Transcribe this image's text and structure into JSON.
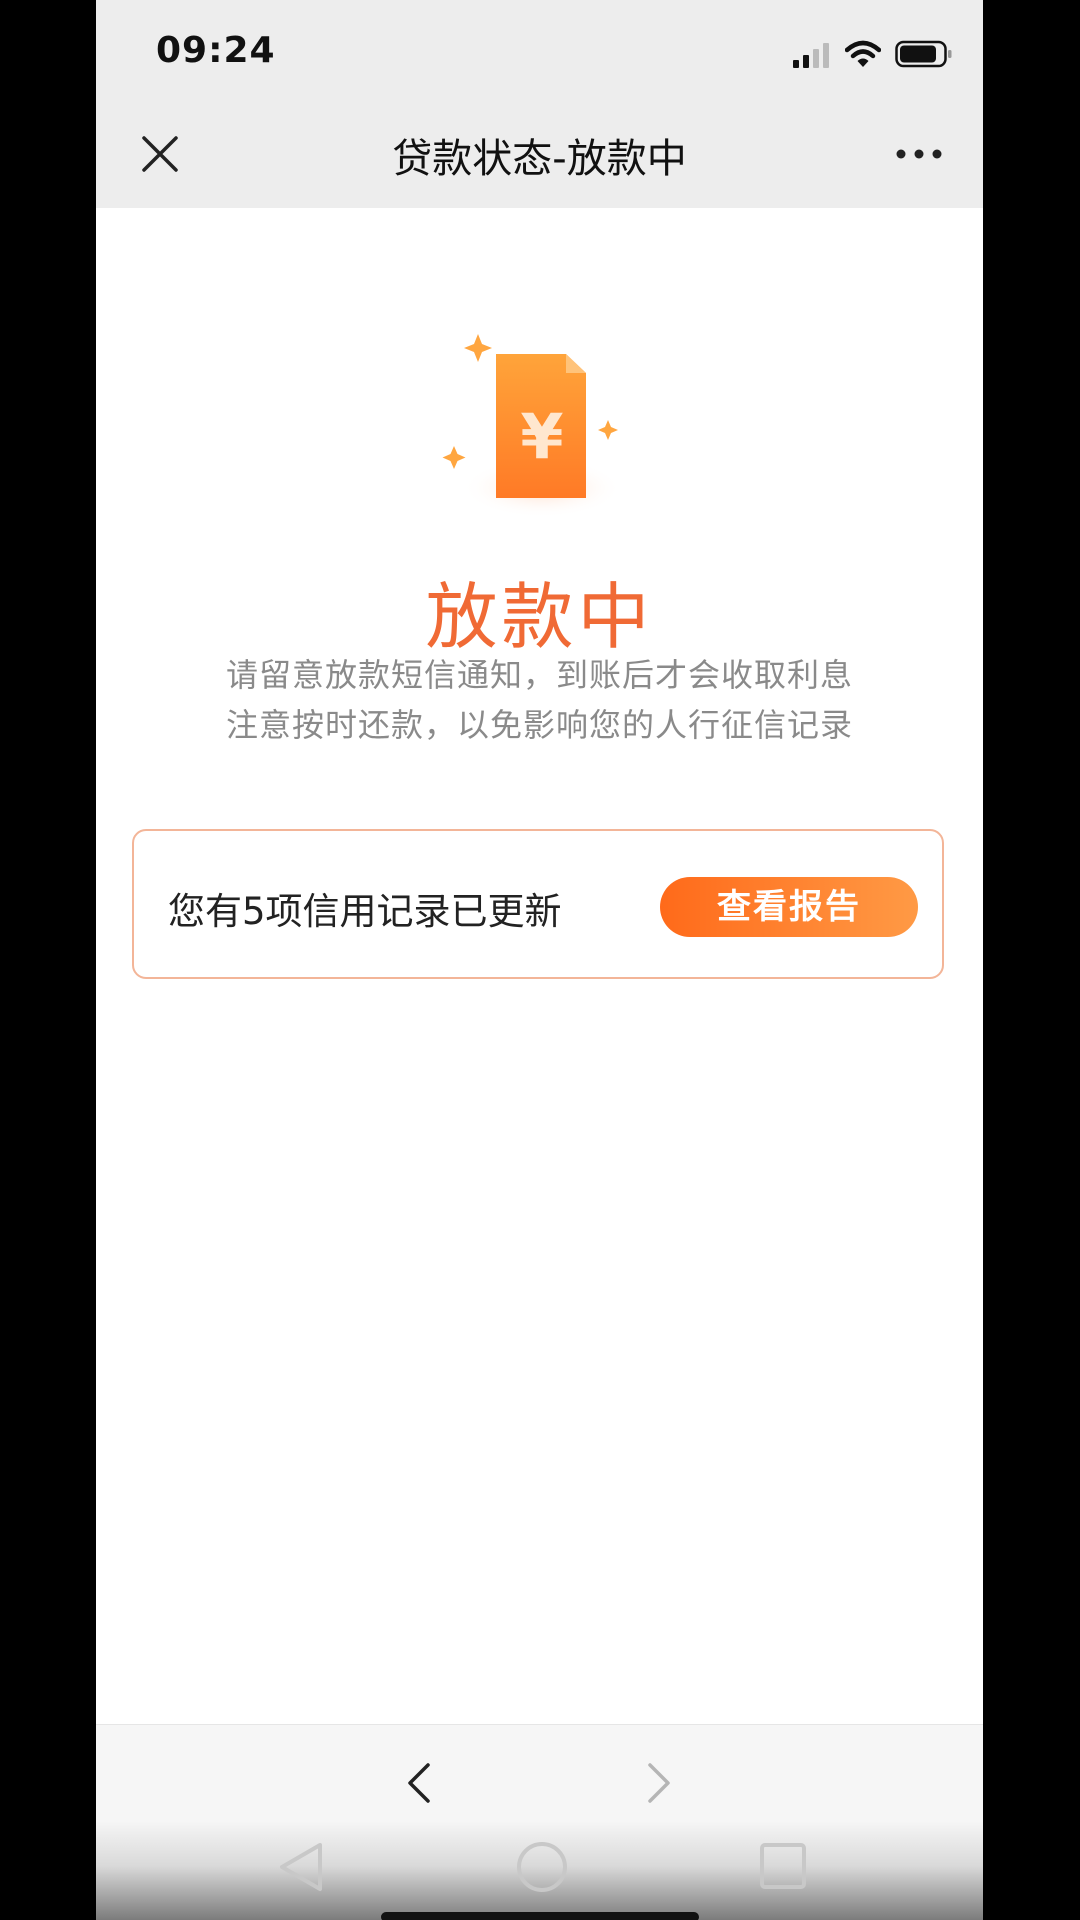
{
  "status_bar": {
    "time": "09:24",
    "icons": [
      "cellular-signal-icon",
      "wifi-icon",
      "battery-icon"
    ]
  },
  "nav": {
    "title": "贷款状态-放款中",
    "close_icon": "close-icon",
    "more_icon": "more-icon"
  },
  "main": {
    "illustration_icon": "yuan-document-icon",
    "heading": "放款中",
    "notice_lines": [
      "请留意放款短信通知，到账后才会收取利息",
      "注意按时还款，以免影响您的人行征信记录"
    ],
    "credit_card": {
      "text": "您有5项信用记录已更新",
      "button_label": "查看报告"
    }
  },
  "browser_bar": {
    "back_icon": "back-arrow-icon",
    "forward_icon": "forward-arrow-icon"
  },
  "system_nav": {
    "icons": [
      "android-back-icon",
      "android-home-icon",
      "android-recent-icon"
    ]
  },
  "colors": {
    "accent": "#f06a35",
    "button_gradient_start": "#ff6a1a",
    "button_gradient_end": "#ff9a45",
    "card_border": "#f3b598",
    "header_bg": "#ededed"
  }
}
